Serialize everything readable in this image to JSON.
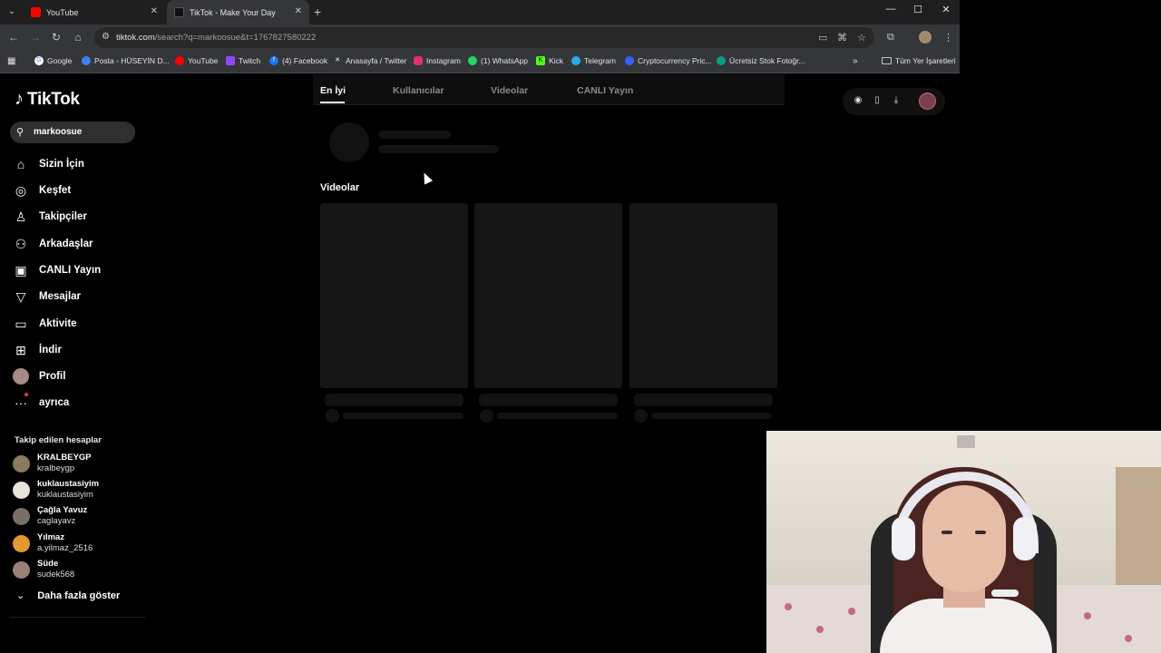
{
  "browser": {
    "tabs": [
      {
        "title": "YouTube",
        "active": false
      },
      {
        "title": "TikTok - Make Your Day",
        "active": true
      }
    ],
    "url_host": "tiktok.com",
    "url_rest": "/search?q=markoosue&t=1767827580222",
    "bookmarks": [
      {
        "label": "Google",
        "icon": "google-icon",
        "color": "#4285f4"
      },
      {
        "label": "Posta - HÜSEYİN D...",
        "icon": "mail-icon",
        "color": "#3b82f6"
      },
      {
        "label": "YouTube",
        "icon": "youtube-icon",
        "color": "#ff0000"
      },
      {
        "label": "Twitch",
        "icon": "twitch-icon",
        "color": "#9146ff"
      },
      {
        "label": "(4) Facebook",
        "icon": "facebook-icon",
        "color": "#1877f2"
      },
      {
        "label": "Anasayfa / Twitter",
        "icon": "x-icon",
        "color": "#000000"
      },
      {
        "label": "Instagram",
        "icon": "instagram-icon",
        "color": "#e1306c"
      },
      {
        "label": "(1) WhatsApp",
        "icon": "whatsapp-icon",
        "color": "#25d366"
      },
      {
        "label": "Kick",
        "icon": "kick-icon",
        "color": "#53fc18"
      },
      {
        "label": "Telegram",
        "icon": "telegram-icon",
        "color": "#2aabee"
      },
      {
        "label": "Cryptocurrency Pric...",
        "icon": "coin-icon",
        "color": "#3861fb"
      },
      {
        "label": "Ücretsiz Stok Fotoğr...",
        "icon": "pexels-icon",
        "color": "#05a081"
      }
    ],
    "all_bookmarks": "Tüm Yer İşaretleri"
  },
  "tiktok": {
    "logo": "TikTok",
    "search_value": "markoosue",
    "nav": [
      {
        "label": "Sizin İçin",
        "icon": "home-icon"
      },
      {
        "label": "Keşfet",
        "icon": "compass-icon"
      },
      {
        "label": "Takipçiler",
        "icon": "follow-icon"
      },
      {
        "label": "Arkadaşlar",
        "icon": "friends-icon"
      },
      {
        "label": "CANLI Yayın",
        "icon": "live-icon"
      },
      {
        "label": "Mesajlar",
        "icon": "message-icon"
      },
      {
        "label": "Aktivite",
        "icon": "activity-icon"
      },
      {
        "label": "İndir",
        "icon": "download-icon"
      },
      {
        "label": "Profil",
        "icon": "profile-avatar"
      },
      {
        "label": "ayrıca",
        "icon": "more-icon"
      }
    ],
    "following_title": "Takip edilen hesaplar",
    "accounts": [
      {
        "name": "KRALBEYGP",
        "handle": "kralbeygp",
        "color": "#8a7a60"
      },
      {
        "name": "kuklaustasiyim",
        "handle": "kuklaustasiyim",
        "color": "#e8e2d8"
      },
      {
        "name": "Çağla Yavuz",
        "handle": "caglayavz",
        "color": "#7a6e66"
      },
      {
        "name": "Yılmaz",
        "handle": "a.yilmaz_2516",
        "color": "#e09a30"
      },
      {
        "name": "Süde",
        "handle": "sudek568",
        "color": "#9a8078"
      }
    ],
    "show_more": "Daha fazla göster",
    "tabs": [
      {
        "label": "En İyi",
        "active": true
      },
      {
        "label": "Kullanıcılar",
        "active": false
      },
      {
        "label": "Videolar",
        "active": false
      },
      {
        "label": "CANLI Yayın",
        "active": false
      }
    ],
    "videos_title": "Videolar"
  }
}
